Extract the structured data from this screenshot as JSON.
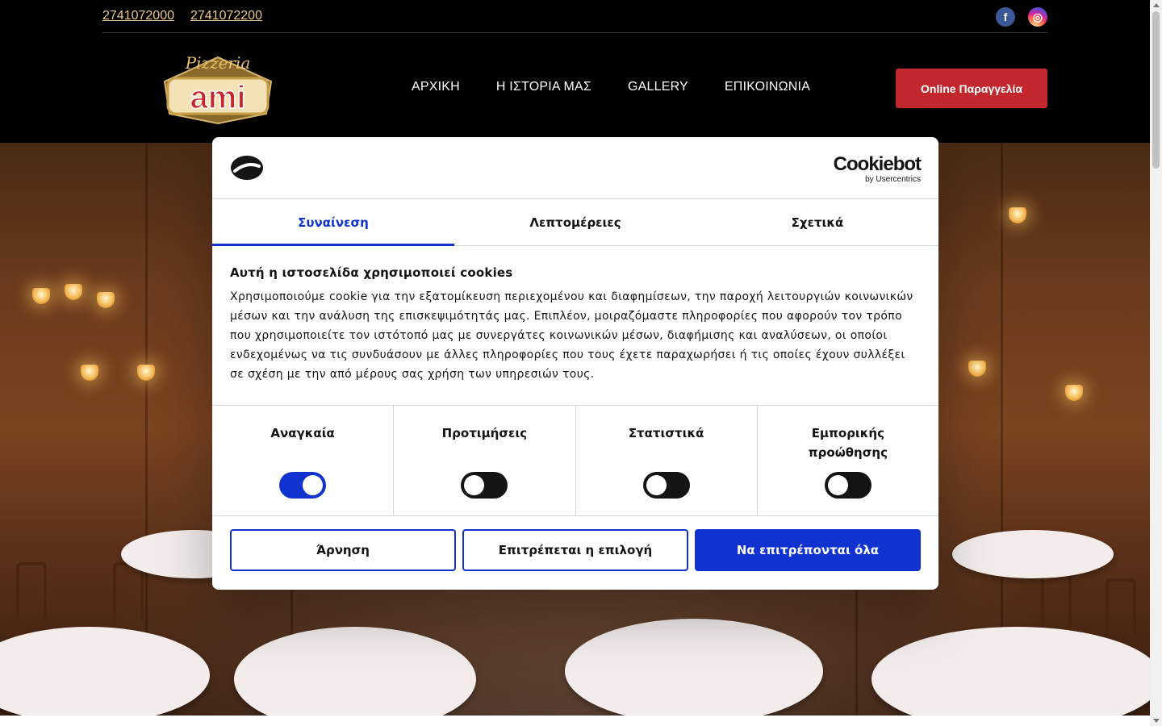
{
  "topbar": {
    "phones": [
      "2741072000",
      "2741072200"
    ],
    "socials": [
      {
        "name": "facebook",
        "glyph": "f"
      },
      {
        "name": "instagram",
        "glyph": "◎"
      }
    ]
  },
  "header": {
    "logo": {
      "script_text": "Pizzeria",
      "brand_text": "ami"
    },
    "nav": [
      "ΑΡΧΙΚΗ",
      "Η ΙΣΤΟΡΙΑ ΜΑΣ",
      "GALLERY",
      "ΕΠΙΚΟΙΝΩΝΙΑ"
    ],
    "order_button": "Online Παραγγελία"
  },
  "cookie_dialog": {
    "brand": {
      "name": "Cookiebot",
      "by": "by Usercentrics"
    },
    "tabs": [
      {
        "label": "Συναίνεση",
        "active": true
      },
      {
        "label": "Λεπτομέρειες",
        "active": false
      },
      {
        "label": "Σχετικά",
        "active": false
      }
    ],
    "title": "Αυτή η ιστοσελίδα χρησιμοποιεί cookies",
    "text": "Χρησιμοποιούμε cookie για την εξατομίκευση περιεχομένου και διαφημίσεων, την παροχή λειτουργιών κοινωνικών μέσων και την ανάλυση της επισκεψιμότητάς μας. Επιπλέον, μοιραζόμαστε πληροφορίες που αφορούν τον τρόπο που χρησιμοποιείτε τον ιστότοπό μας με συνεργάτες κοινωνικών μέσων, διαφήμισης και αναλύσεων, οι οποίοι ενδεχομένως να τις συνδυάσουν με άλλες πληροφορίες που τους έχετε παραχωρήσει ή τις οποίες έχουν συλλέξει σε σχέση με την από μέρους σας χρήση των υπηρεσιών τους.",
    "categories": [
      {
        "label": "Αναγκαία",
        "enabled": true
      },
      {
        "label": "Προτιμήσεις",
        "enabled": false
      },
      {
        "label": "Στατιστικά",
        "enabled": false
      },
      {
        "label": "Εμπορικής προώθησης",
        "enabled": false
      }
    ],
    "buttons": {
      "deny": "Άρνηση",
      "allow_selection": "Επιτρέπεται η επιλογή",
      "allow_all": "Να επιτρέπονται όλα"
    }
  },
  "colors": {
    "accent": "#1032cf",
    "order_button": "#c1272d",
    "phone_link": "#e9c98f"
  }
}
